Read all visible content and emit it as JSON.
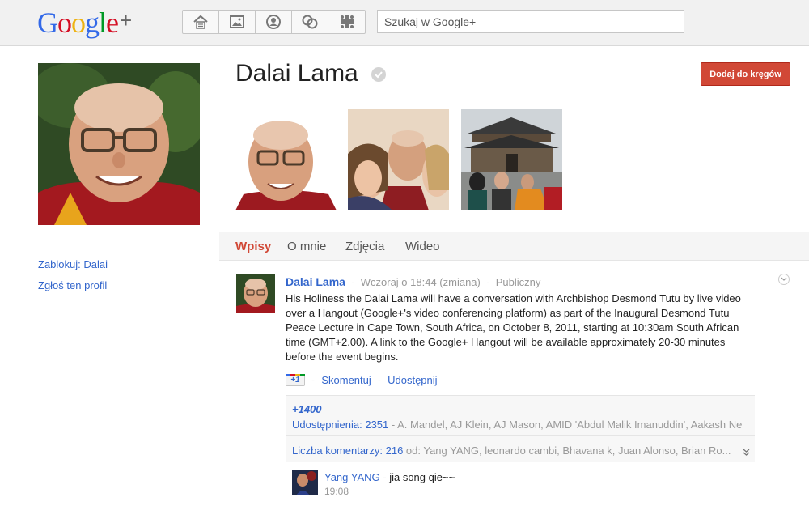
{
  "header": {
    "logo_letters": [
      "G",
      "o",
      "o",
      "g",
      "l",
      "e"
    ],
    "logo_plus": "+",
    "search_placeholder": "Szukaj w Google+",
    "nav_icons": [
      "home-icon",
      "photos-icon",
      "profile-icon",
      "circles-icon",
      "games-icon"
    ]
  },
  "sidebar": {
    "block_link": "Zablokuj: Dalai",
    "report_link": "Zgłoś ten profil"
  },
  "profile": {
    "name": "Dalai Lama",
    "add_button": "Dodaj do kręgów"
  },
  "tabs": [
    {
      "label": "Wpisy",
      "active": true
    },
    {
      "label": "O mnie",
      "active": false
    },
    {
      "label": "Zdjęcia",
      "active": false
    },
    {
      "label": "Wideo",
      "active": false
    }
  ],
  "post": {
    "author": "Dalai Lama",
    "sep": "-",
    "time": "Wczoraj o 18:44 (zmiana)",
    "visibility": "Publiczny",
    "text": "His Holiness the Dalai Lama will have a conversation with Archbishop Desmond Tutu by live video over a Hangout (Google+'s video conferencing platform) as part of the Inaugural Desmond Tutu Peace Lecture in Cape Town, South Africa, on October 8, 2011, starting at 10:30am South African time (GMT+2.00). A link to the Google+ Hangout will be available approximately 20-30 minutes before the event begins.",
    "plus_one": "+1",
    "comment_label": "Skomentuj",
    "share_label": "Udostępnij",
    "plus_count": "+1400",
    "shares_label": "Udostępnienia: 2351",
    "shares_names": " - A. Mandel, AJ Klein, AJ Mason, AMID 'Abdul Malik Imanuddin', Aakash Ne",
    "comments_label": "Liczba komentarzy: 216",
    "comments_names": " od: Yang YANG, leonardo cambi, Bhavana k, Juan Alonso, Brian Ro..."
  },
  "comment": {
    "author": "Yang YANG",
    "text": " - jia song qie~~",
    "time": "19:08"
  },
  "colors": {
    "accent_red": "#d14836",
    "link_blue": "#3366cc"
  }
}
